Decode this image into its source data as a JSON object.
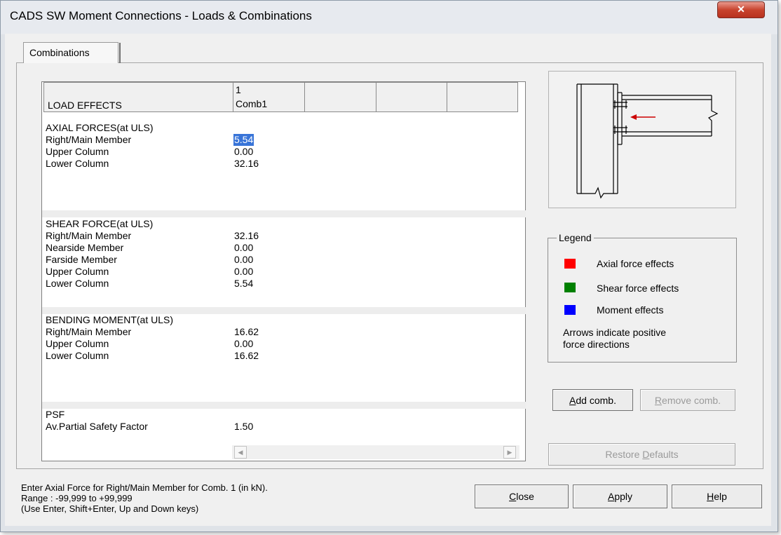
{
  "window": {
    "title": "CADS SW Moment Connections - Loads & Combinations",
    "close_glyph": "✕"
  },
  "tabs": [
    {
      "label": "Combinations"
    }
  ],
  "grid": {
    "header": {
      "load_effects": "LOAD EFFECTS",
      "col_number": "1",
      "col_name": "Comb1"
    },
    "axial": {
      "heading": "AXIAL FORCES(at ULS)",
      "rows": [
        {
          "label": "Right/Main Member",
          "value": "5.54"
        },
        {
          "label": "Upper Column",
          "value": "0.00"
        },
        {
          "label": "Lower Column",
          "value": "32.16"
        }
      ]
    },
    "shear": {
      "heading": "SHEAR FORCE(at ULS)",
      "rows": [
        {
          "label": "Right/Main Member",
          "value": "32.16"
        },
        {
          "label": "Nearside Member",
          "value": "0.00"
        },
        {
          "label": "Farside Member",
          "value": "0.00"
        },
        {
          "label": "Upper Column",
          "value": "0.00"
        },
        {
          "label": "Lower Column",
          "value": "5.54"
        }
      ]
    },
    "bending": {
      "heading": "BENDING MOMENT(at ULS)",
      "rows": [
        {
          "label": "Right/Main Member",
          "value": "16.62"
        },
        {
          "label": "Upper Column",
          "value": "0.00"
        },
        {
          "label": "Lower Column",
          "value": "16.62"
        }
      ]
    },
    "psf": {
      "heading": "PSF",
      "rows": [
        {
          "label": "Av.Partial Safety Factor",
          "value": "1.50"
        }
      ]
    },
    "scroll_left": "◀",
    "scroll_right": "▶"
  },
  "legend": {
    "title": "Legend",
    "items": [
      {
        "label": "Axial force effects",
        "color": "#ff0000"
      },
      {
        "label": "Shear force effects",
        "color": "#008000"
      },
      {
        "label": "Moment effects",
        "color": "#0000ff"
      }
    ],
    "note_line1": "Arrows indicate positive",
    "note_line2": "force directions"
  },
  "buttons": {
    "add_comb_u": "A",
    "add_comb_rest": "dd comb.",
    "remove_comb_u": "R",
    "remove_comb_rest": "emove comb.",
    "restore_a": "Restore ",
    "restore_u": "D",
    "restore_b": "efaults",
    "close_u": "C",
    "close_rest": "lose",
    "apply_u": "A",
    "apply_rest": "pply",
    "help_u": "H",
    "help_rest": "elp"
  },
  "status": {
    "line1": "Enter Axial Force for Right/Main Member for Comb. 1 (in kN).",
    "line2": "Range  : -99,999 to +99,999",
    "line3": "(Use Enter, Shift+Enter, Up and Down keys)"
  },
  "colors": {
    "selection": "#3874d8",
    "arrow": "#cc0000"
  }
}
